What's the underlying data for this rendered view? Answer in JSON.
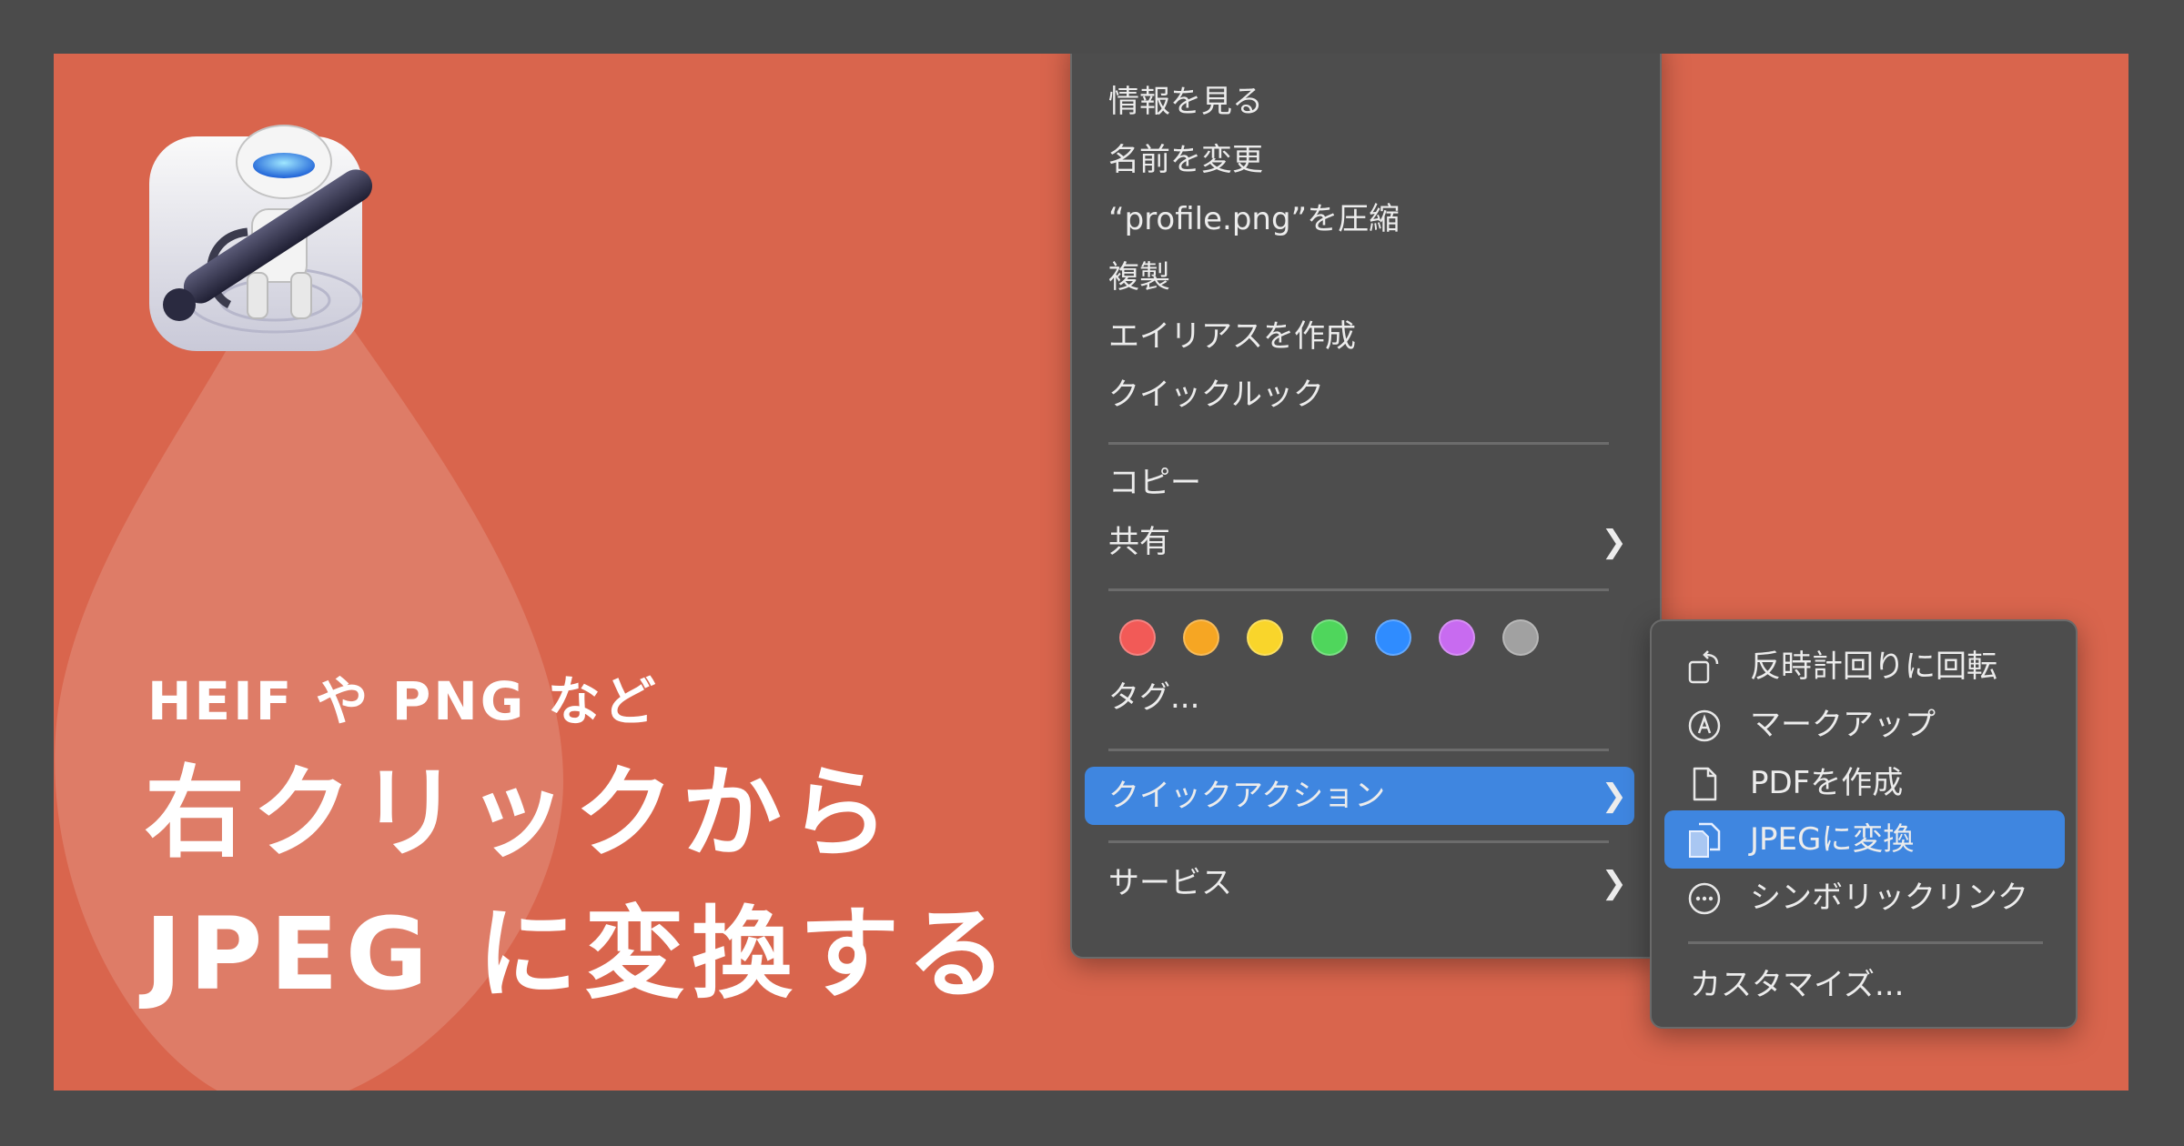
{
  "banner": {
    "subtitle": "HEIF や PNG など",
    "title_line1": "右クリックから",
    "title_line2": "JPEG に変換する"
  },
  "context_menu": {
    "items_group1": [
      "情報を見る",
      "名前を変更",
      "“profile.png”を圧縮",
      "複製",
      "エイリアスを作成",
      "クイックルック"
    ],
    "copy": "コピー",
    "share": "共有",
    "tag_colors": [
      "#f25a57",
      "#f6a623",
      "#f9d52b",
      "#4fd65c",
      "#2f8cff",
      "#c86bf0",
      "#a1a1a1"
    ],
    "tags": "タグ...",
    "quick_actions": "クイックアクション",
    "services": "サービス",
    "highlight_color": "#3f86e0"
  },
  "submenu": {
    "rotate": "反時計回りに回転",
    "markup": "マークアップ",
    "create_pdf": "PDFを作成",
    "convert_jpeg": "JPEGに変換",
    "symlink": "シンボリックリンク",
    "customize": "カスタマイズ..."
  },
  "colors": {
    "background": "#d9654d",
    "frame": "#4b4b4b",
    "menu": "#4d4d4d"
  }
}
